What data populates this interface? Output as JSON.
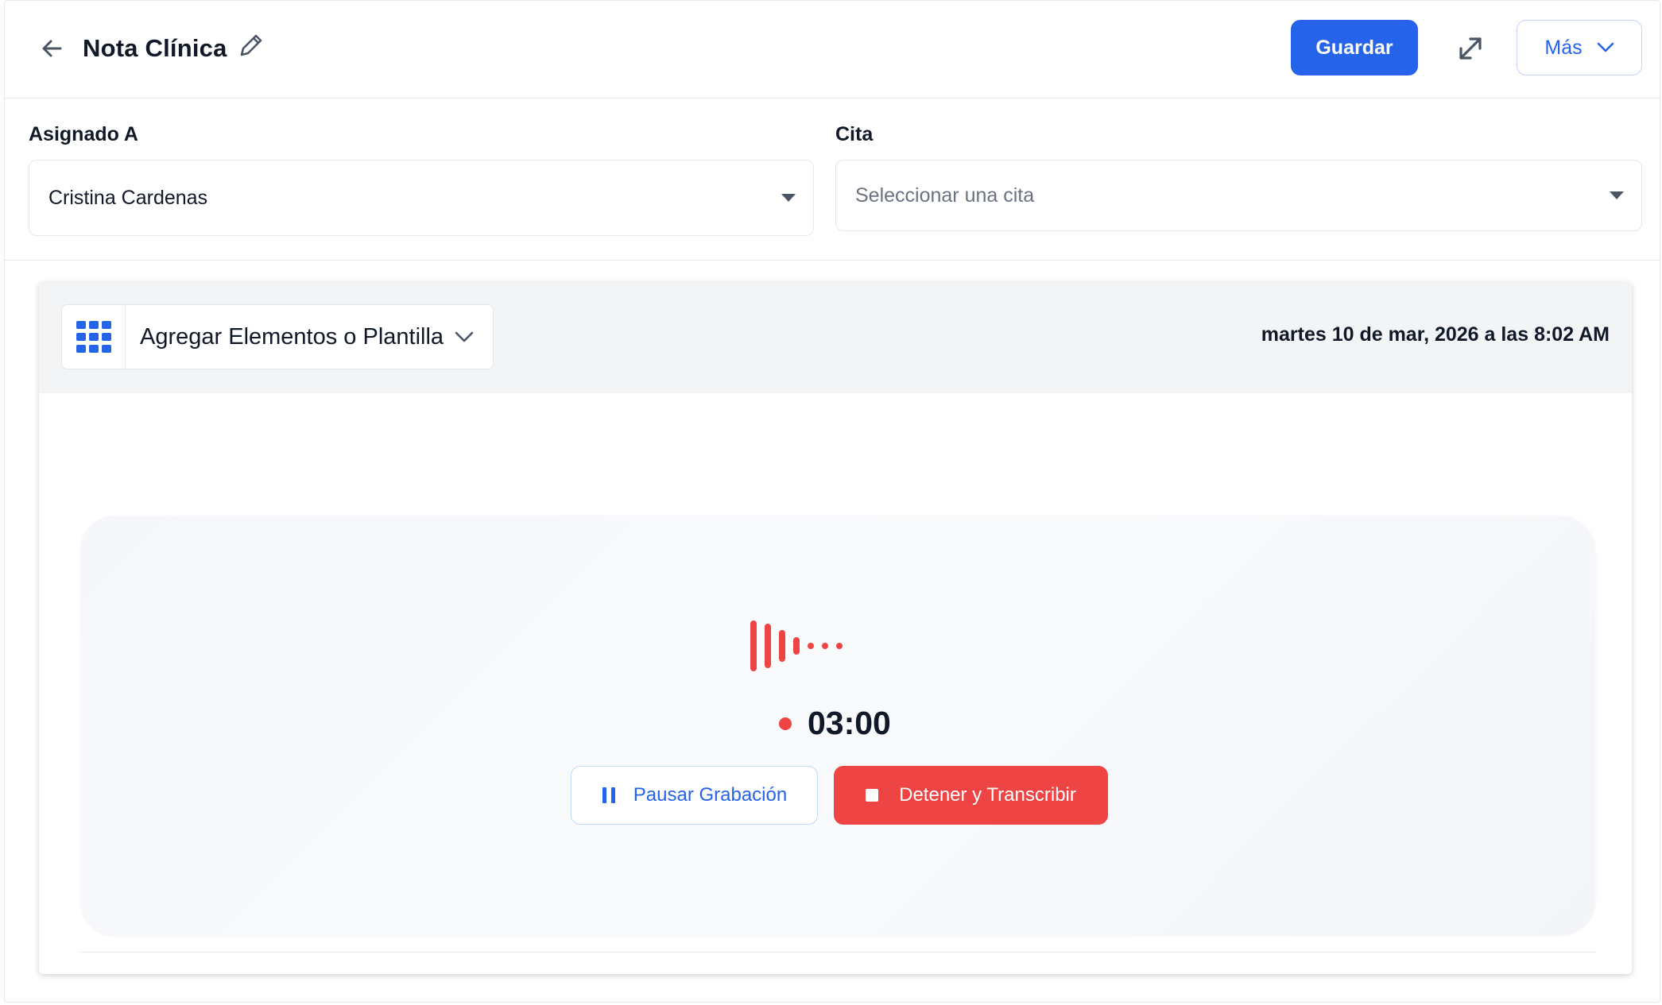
{
  "header": {
    "title": "Nota Clínica",
    "save_label": "Guardar",
    "more_label": "Más"
  },
  "fields": {
    "assigned": {
      "label": "Asignado A",
      "value": "Cristina Cardenas"
    },
    "appointment": {
      "label": "Cita",
      "placeholder": "Seleccionar una cita"
    }
  },
  "toolbar": {
    "template_label": "Agregar Elementos o Plantilla",
    "datetime": "martes 10 de mar, 2026 a las 8:02 AM"
  },
  "recorder": {
    "timer": "03:00",
    "pause_label": "Pausar Grabación",
    "stop_label": "Detener y Transcribir"
  },
  "colors": {
    "accent": "#2563eb",
    "record": "#ef4444"
  },
  "icons": [
    "back-arrow-icon",
    "pencil-icon",
    "expand-icon",
    "chevron-down-icon",
    "grid-icon",
    "waveform-icon",
    "pause-icon",
    "stop-icon"
  ]
}
